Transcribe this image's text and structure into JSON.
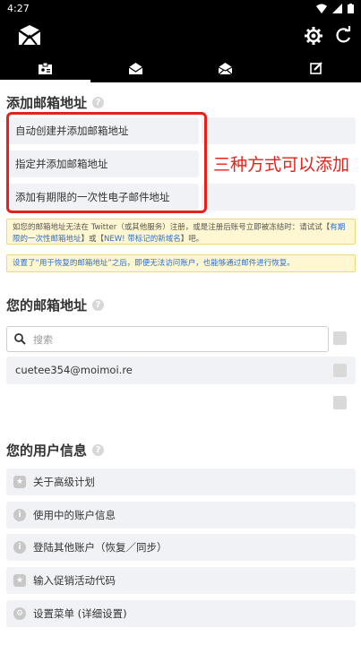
{
  "status_bar": {
    "time": "4:27"
  },
  "tabs": [
    {
      "icon": "id-card-icon",
      "active": true
    },
    {
      "icon": "mail-open-icon",
      "active": false
    },
    {
      "icon": "mail-icon",
      "active": false
    },
    {
      "icon": "edit-icon",
      "active": false
    }
  ],
  "add_section": {
    "title": "添加邮箱地址",
    "options": [
      "自动创建并添加邮箱地址",
      "指定并添加邮箱地址",
      "添加有期限的一次性电子邮件地址"
    ],
    "annotation": "三种方式可以添加",
    "notice1_a": "如您的邮箱地址无法在 Twitter（或其他服务）注册，或是注册后账号立即被冻结时：请试试【",
    "notice1_link1": "有期限的一次性邮箱地址",
    "notice1_b": "】或【",
    "notice1_link2": "NEW! 带标记的新域名",
    "notice1_c": "】吧。",
    "notice2": "设置了“用于恢复的邮箱地址”之后，即便无法访问账户，也能够通过邮件进行恢复。"
  },
  "address_section": {
    "title": "您的邮箱地址",
    "search_placeholder": "搜索",
    "emails": [
      "cuetee354@moimoi.re"
    ]
  },
  "user_section": {
    "title": "您的用户信息",
    "items": [
      {
        "label": "关于高级计划",
        "icon": "star-icon"
      },
      {
        "label": "使用中的账户信息",
        "icon": "info-icon"
      },
      {
        "label": "登陆其他账户（恢复／同步）",
        "icon": "info-icon"
      },
      {
        "label": "输入促销活动代码",
        "icon": "star-icon"
      },
      {
        "label": "设置菜单 (详细设置)",
        "icon": "gear-icon"
      }
    ]
  },
  "colors": {
    "accent": "#e8201a",
    "bar": "#000000",
    "row_bg": "#f1f2f5",
    "notice_bg": "#fff7d1",
    "link": "#2a6fd0"
  }
}
